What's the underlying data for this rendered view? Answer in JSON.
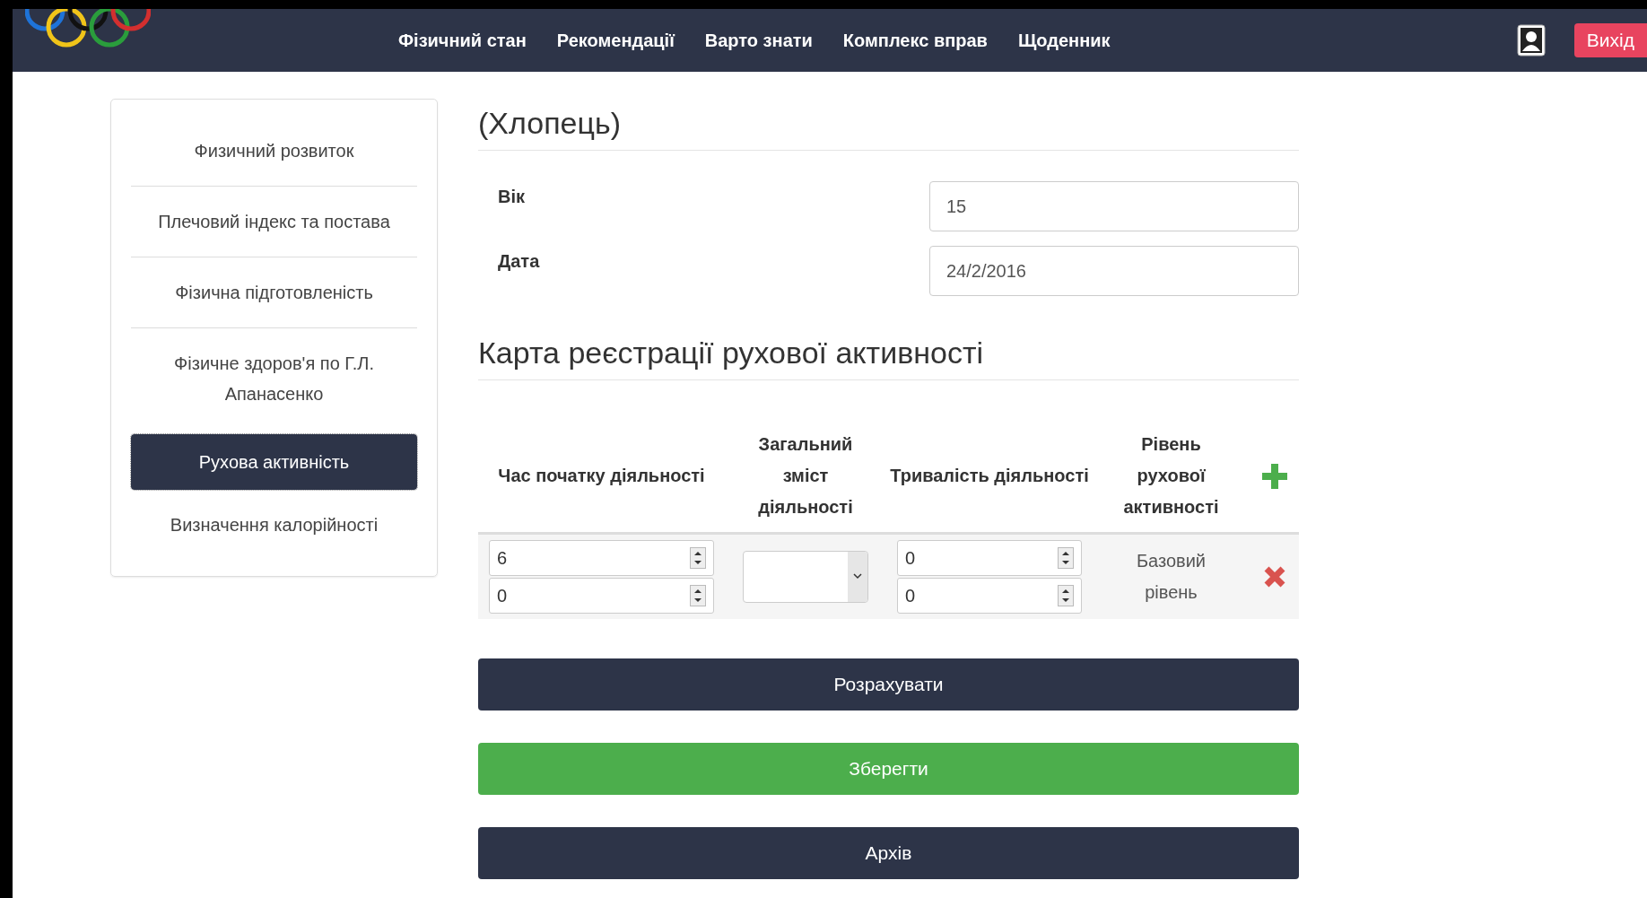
{
  "navbar": {
    "items": [
      {
        "label": "Фізичний стан"
      },
      {
        "label": "Рекомендації"
      },
      {
        "label": "Варто знати"
      },
      {
        "label": "Комплекс вправ"
      },
      {
        "label": "Щоденник"
      }
    ],
    "logout": "Вихід"
  },
  "sidebar": {
    "items": [
      {
        "label": "Физичний розвиток",
        "selected": false
      },
      {
        "label": "Плечовий індекс та постава",
        "selected": false
      },
      {
        "label": "Фізична підготовленість",
        "selected": false
      },
      {
        "label": "Фізичне здоров'я по Г.Л. Апанасенко",
        "selected": false
      },
      {
        "label": "Рухова активність",
        "selected": true
      },
      {
        "label": "Визначення калорійності",
        "selected": false
      }
    ]
  },
  "profile": {
    "heading": "(Хлопець)",
    "fields": [
      {
        "label": "Вік",
        "value": "15"
      },
      {
        "label": "Дата",
        "value": "24/2/2016"
      }
    ]
  },
  "activity": {
    "title": "Карта реєстрації рухової активності",
    "columns": [
      "Час початку діяльності",
      "Загальний зміст діяльності",
      "Тривалість діяльності",
      "Рівень рухової активності"
    ],
    "rows": [
      {
        "start": [
          "6",
          "0"
        ],
        "duration": [
          "0",
          "0"
        ],
        "level": "Базовий рівень"
      }
    ]
  },
  "buttons": [
    {
      "label": "Розрахувати",
      "kind": "primary"
    },
    {
      "label": "Зберегти",
      "kind": "success"
    },
    {
      "label": "Архів",
      "kind": "primary"
    }
  ]
}
